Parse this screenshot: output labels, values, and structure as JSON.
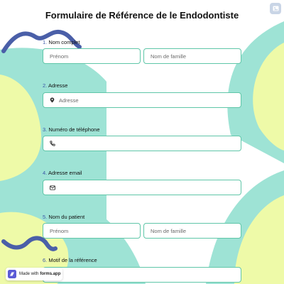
{
  "form": {
    "title": "Formulaire de Référence de le Endodontiste"
  },
  "questions": [
    {
      "number": "1.",
      "label": "Nom complet",
      "fields": [
        {
          "placeholder": "Prénom"
        },
        {
          "placeholder": "Nom de famille"
        }
      ]
    },
    {
      "number": "2.",
      "label": "Adresse",
      "fields": [
        {
          "placeholder": "Adresse",
          "icon": "location-pin-icon"
        }
      ]
    },
    {
      "number": "3.",
      "label": "Numéro de téléphone",
      "fields": [
        {
          "placeholder": "",
          "icon": "phone-icon"
        }
      ]
    },
    {
      "number": "4.",
      "label": "Adresse email",
      "fields": [
        {
          "placeholder": "",
          "icon": "envelope-icon"
        }
      ]
    },
    {
      "number": "5.",
      "label": "Nom du patient",
      "fields": [
        {
          "placeholder": "Prénom"
        },
        {
          "placeholder": "Nom de famille"
        }
      ]
    },
    {
      "number": "6.",
      "label": "Motif de la référence",
      "fields": []
    }
  ],
  "badge": {
    "prefix": "Made with",
    "brand": "forms.app"
  },
  "colors": {
    "accent_number": "#3b57a6",
    "field_border": "#5fc6a8",
    "blob_teal": "#9ee3d5",
    "blob_yellow": "#eefaa8",
    "squiggle": "#4a5fa8"
  }
}
